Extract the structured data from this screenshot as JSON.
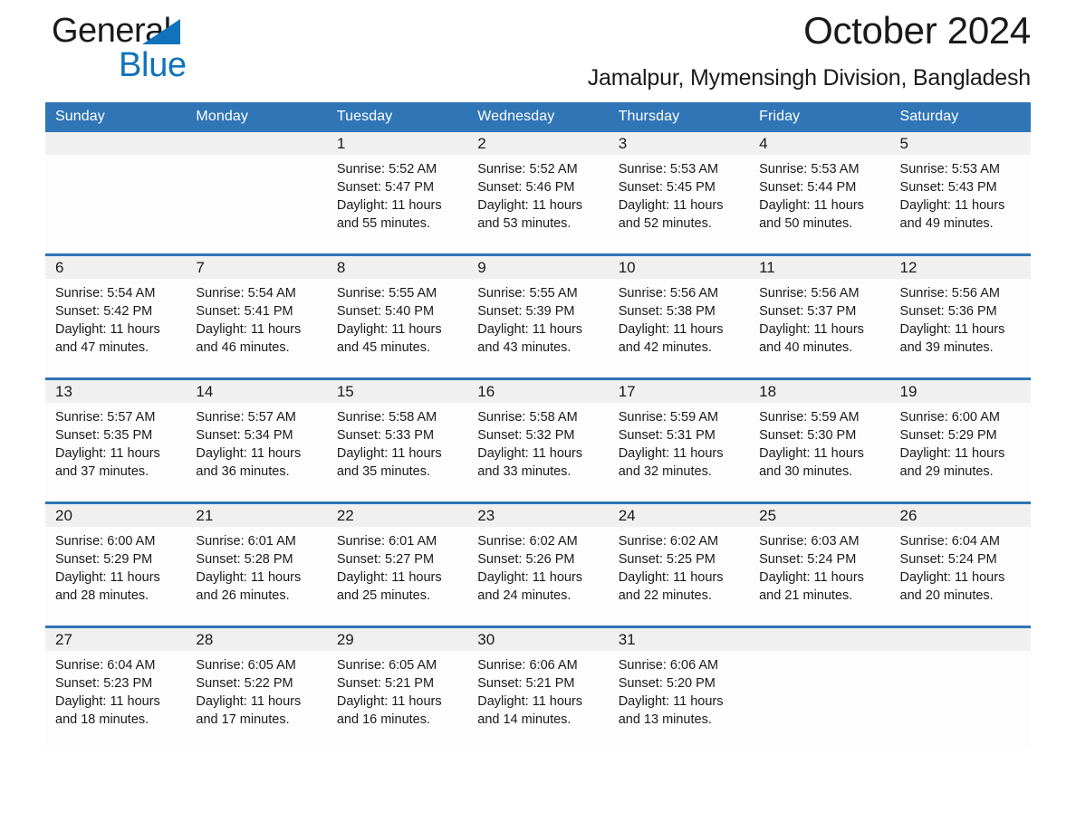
{
  "brand": {
    "name_part1": "General",
    "name_part2": "Blue",
    "accent_color": "#1173bb"
  },
  "header": {
    "title": "October 2024",
    "subtitle": "Jamalpur, Mymensingh Division, Bangladesh",
    "header_bg_color": "#3075b5"
  },
  "calendar": {
    "weekday_headers": [
      "Sunday",
      "Monday",
      "Tuesday",
      "Wednesday",
      "Thursday",
      "Friday",
      "Saturday"
    ],
    "weeks": [
      [
        {
          "day": "",
          "blank": true
        },
        {
          "day": "",
          "blank": true
        },
        {
          "day": "1",
          "sunrise": "Sunrise: 5:52 AM",
          "sunset": "Sunset: 5:47 PM",
          "daylight_line1": "Daylight: 11 hours",
          "daylight_line2": "and 55 minutes."
        },
        {
          "day": "2",
          "sunrise": "Sunrise: 5:52 AM",
          "sunset": "Sunset: 5:46 PM",
          "daylight_line1": "Daylight: 11 hours",
          "daylight_line2": "and 53 minutes."
        },
        {
          "day": "3",
          "sunrise": "Sunrise: 5:53 AM",
          "sunset": "Sunset: 5:45 PM",
          "daylight_line1": "Daylight: 11 hours",
          "daylight_line2": "and 52 minutes."
        },
        {
          "day": "4",
          "sunrise": "Sunrise: 5:53 AM",
          "sunset": "Sunset: 5:44 PM",
          "daylight_line1": "Daylight: 11 hours",
          "daylight_line2": "and 50 minutes."
        },
        {
          "day": "5",
          "sunrise": "Sunrise: 5:53 AM",
          "sunset": "Sunset: 5:43 PM",
          "daylight_line1": "Daylight: 11 hours",
          "daylight_line2": "and 49 minutes."
        }
      ],
      [
        {
          "day": "6",
          "sunrise": "Sunrise: 5:54 AM",
          "sunset": "Sunset: 5:42 PM",
          "daylight_line1": "Daylight: 11 hours",
          "daylight_line2": "and 47 minutes."
        },
        {
          "day": "7",
          "sunrise": "Sunrise: 5:54 AM",
          "sunset": "Sunset: 5:41 PM",
          "daylight_line1": "Daylight: 11 hours",
          "daylight_line2": "and 46 minutes."
        },
        {
          "day": "8",
          "sunrise": "Sunrise: 5:55 AM",
          "sunset": "Sunset: 5:40 PM",
          "daylight_line1": "Daylight: 11 hours",
          "daylight_line2": "and 45 minutes."
        },
        {
          "day": "9",
          "sunrise": "Sunrise: 5:55 AM",
          "sunset": "Sunset: 5:39 PM",
          "daylight_line1": "Daylight: 11 hours",
          "daylight_line2": "and 43 minutes."
        },
        {
          "day": "10",
          "sunrise": "Sunrise: 5:56 AM",
          "sunset": "Sunset: 5:38 PM",
          "daylight_line1": "Daylight: 11 hours",
          "daylight_line2": "and 42 minutes."
        },
        {
          "day": "11",
          "sunrise": "Sunrise: 5:56 AM",
          "sunset": "Sunset: 5:37 PM",
          "daylight_line1": "Daylight: 11 hours",
          "daylight_line2": "and 40 minutes."
        },
        {
          "day": "12",
          "sunrise": "Sunrise: 5:56 AM",
          "sunset": "Sunset: 5:36 PM",
          "daylight_line1": "Daylight: 11 hours",
          "daylight_line2": "and 39 minutes."
        }
      ],
      [
        {
          "day": "13",
          "sunrise": "Sunrise: 5:57 AM",
          "sunset": "Sunset: 5:35 PM",
          "daylight_line1": "Daylight: 11 hours",
          "daylight_line2": "and 37 minutes."
        },
        {
          "day": "14",
          "sunrise": "Sunrise: 5:57 AM",
          "sunset": "Sunset: 5:34 PM",
          "daylight_line1": "Daylight: 11 hours",
          "daylight_line2": "and 36 minutes."
        },
        {
          "day": "15",
          "sunrise": "Sunrise: 5:58 AM",
          "sunset": "Sunset: 5:33 PM",
          "daylight_line1": "Daylight: 11 hours",
          "daylight_line2": "and 35 minutes."
        },
        {
          "day": "16",
          "sunrise": "Sunrise: 5:58 AM",
          "sunset": "Sunset: 5:32 PM",
          "daylight_line1": "Daylight: 11 hours",
          "daylight_line2": "and 33 minutes."
        },
        {
          "day": "17",
          "sunrise": "Sunrise: 5:59 AM",
          "sunset": "Sunset: 5:31 PM",
          "daylight_line1": "Daylight: 11 hours",
          "daylight_line2": "and 32 minutes."
        },
        {
          "day": "18",
          "sunrise": "Sunrise: 5:59 AM",
          "sunset": "Sunset: 5:30 PM",
          "daylight_line1": "Daylight: 11 hours",
          "daylight_line2": "and 30 minutes."
        },
        {
          "day": "19",
          "sunrise": "Sunrise: 6:00 AM",
          "sunset": "Sunset: 5:29 PM",
          "daylight_line1": "Daylight: 11 hours",
          "daylight_line2": "and 29 minutes."
        }
      ],
      [
        {
          "day": "20",
          "sunrise": "Sunrise: 6:00 AM",
          "sunset": "Sunset: 5:29 PM",
          "daylight_line1": "Daylight: 11 hours",
          "daylight_line2": "and 28 minutes."
        },
        {
          "day": "21",
          "sunrise": "Sunrise: 6:01 AM",
          "sunset": "Sunset: 5:28 PM",
          "daylight_line1": "Daylight: 11 hours",
          "daylight_line2": "and 26 minutes."
        },
        {
          "day": "22",
          "sunrise": "Sunrise: 6:01 AM",
          "sunset": "Sunset: 5:27 PM",
          "daylight_line1": "Daylight: 11 hours",
          "daylight_line2": "and 25 minutes."
        },
        {
          "day": "23",
          "sunrise": "Sunrise: 6:02 AM",
          "sunset": "Sunset: 5:26 PM",
          "daylight_line1": "Daylight: 11 hours",
          "daylight_line2": "and 24 minutes."
        },
        {
          "day": "24",
          "sunrise": "Sunrise: 6:02 AM",
          "sunset": "Sunset: 5:25 PM",
          "daylight_line1": "Daylight: 11 hours",
          "daylight_line2": "and 22 minutes."
        },
        {
          "day": "25",
          "sunrise": "Sunrise: 6:03 AM",
          "sunset": "Sunset: 5:24 PM",
          "daylight_line1": "Daylight: 11 hours",
          "daylight_line2": "and 21 minutes."
        },
        {
          "day": "26",
          "sunrise": "Sunrise: 6:04 AM",
          "sunset": "Sunset: 5:24 PM",
          "daylight_line1": "Daylight: 11 hours",
          "daylight_line2": "and 20 minutes."
        }
      ],
      [
        {
          "day": "27",
          "sunrise": "Sunrise: 6:04 AM",
          "sunset": "Sunset: 5:23 PM",
          "daylight_line1": "Daylight: 11 hours",
          "daylight_line2": "and 18 minutes."
        },
        {
          "day": "28",
          "sunrise": "Sunrise: 6:05 AM",
          "sunset": "Sunset: 5:22 PM",
          "daylight_line1": "Daylight: 11 hours",
          "daylight_line2": "and 17 minutes."
        },
        {
          "day": "29",
          "sunrise": "Sunrise: 6:05 AM",
          "sunset": "Sunset: 5:21 PM",
          "daylight_line1": "Daylight: 11 hours",
          "daylight_line2": "and 16 minutes."
        },
        {
          "day": "30",
          "sunrise": "Sunrise: 6:06 AM",
          "sunset": "Sunset: 5:21 PM",
          "daylight_line1": "Daylight: 11 hours",
          "daylight_line2": "and 14 minutes."
        },
        {
          "day": "31",
          "sunrise": "Sunrise: 6:06 AM",
          "sunset": "Sunset: 5:20 PM",
          "daylight_line1": "Daylight: 11 hours",
          "daylight_line2": "and 13 minutes."
        },
        {
          "day": "",
          "blank": true
        },
        {
          "day": "",
          "blank": true
        }
      ]
    ]
  }
}
